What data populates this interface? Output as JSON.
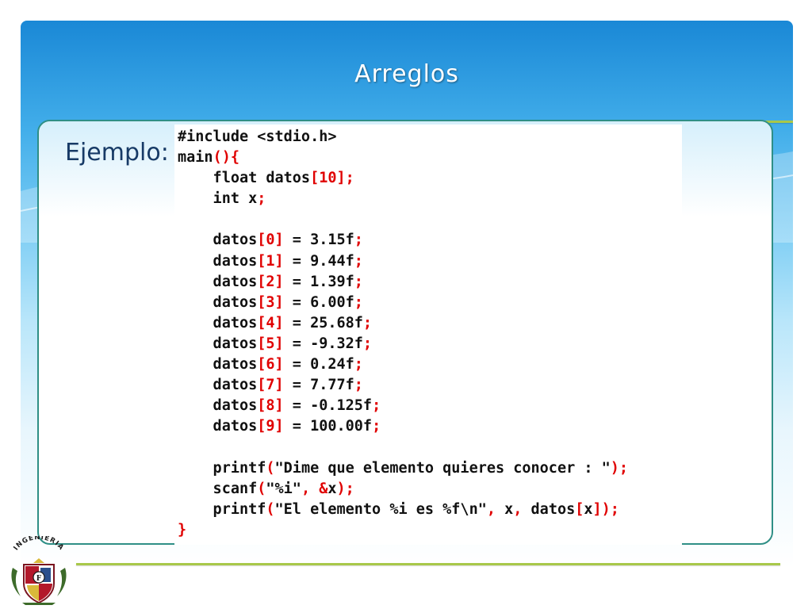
{
  "slide": {
    "title": "Arreglos",
    "example_label": "Ejemplo:",
    "logo_text": "INGENIERIA"
  },
  "colors": {
    "background_top": "#1a88d6",
    "accent_rule": "#a8c84a",
    "box_border": "#2f8f86",
    "label_text": "#173a66",
    "code_default": "#111111",
    "code_highlight": "#e00000"
  },
  "code_lines": [
    [
      {
        "t": "#include <stdio.h>",
        "k": "pre"
      }
    ],
    [
      {
        "t": "main",
        "k": "id"
      },
      {
        "t": "(){",
        "k": "punc"
      }
    ],
    [
      {
        "t": "    float datos",
        "k": "id"
      },
      {
        "t": "[",
        "k": "punc"
      },
      {
        "t": "10",
        "k": "num"
      },
      {
        "t": "];",
        "k": "punc"
      }
    ],
    [
      {
        "t": "    int x",
        "k": "id"
      },
      {
        "t": ";",
        "k": "punc"
      }
    ],
    [
      {
        "t": "",
        "k": "id"
      }
    ],
    [
      {
        "t": "    datos",
        "k": "id"
      },
      {
        "t": "[",
        "k": "punc"
      },
      {
        "t": "0",
        "k": "num"
      },
      {
        "t": "]",
        "k": "punc"
      },
      {
        "t": " = ",
        "k": "id"
      },
      {
        "t": "3.15f",
        "k": "id"
      },
      {
        "t": ";",
        "k": "punc"
      }
    ],
    [
      {
        "t": "    datos",
        "k": "id"
      },
      {
        "t": "[",
        "k": "punc"
      },
      {
        "t": "1",
        "k": "num"
      },
      {
        "t": "]",
        "k": "punc"
      },
      {
        "t": " = ",
        "k": "id"
      },
      {
        "t": "9.44f",
        "k": "id"
      },
      {
        "t": ";",
        "k": "punc"
      }
    ],
    [
      {
        "t": "    datos",
        "k": "id"
      },
      {
        "t": "[",
        "k": "punc"
      },
      {
        "t": "2",
        "k": "num"
      },
      {
        "t": "]",
        "k": "punc"
      },
      {
        "t": " = ",
        "k": "id"
      },
      {
        "t": "1.39f",
        "k": "id"
      },
      {
        "t": ";",
        "k": "punc"
      }
    ],
    [
      {
        "t": "    datos",
        "k": "id"
      },
      {
        "t": "[",
        "k": "punc"
      },
      {
        "t": "3",
        "k": "num"
      },
      {
        "t": "]",
        "k": "punc"
      },
      {
        "t": " = ",
        "k": "id"
      },
      {
        "t": "6.00f",
        "k": "id"
      },
      {
        "t": ";",
        "k": "punc"
      }
    ],
    [
      {
        "t": "    datos",
        "k": "id"
      },
      {
        "t": "[",
        "k": "punc"
      },
      {
        "t": "4",
        "k": "num"
      },
      {
        "t": "]",
        "k": "punc"
      },
      {
        "t": " = ",
        "k": "id"
      },
      {
        "t": "25.68f",
        "k": "id"
      },
      {
        "t": ";",
        "k": "punc"
      }
    ],
    [
      {
        "t": "    datos",
        "k": "id"
      },
      {
        "t": "[",
        "k": "punc"
      },
      {
        "t": "5",
        "k": "num"
      },
      {
        "t": "]",
        "k": "punc"
      },
      {
        "t": " = ",
        "k": "id"
      },
      {
        "t": "-9.32f",
        "k": "id"
      },
      {
        "t": ";",
        "k": "punc"
      }
    ],
    [
      {
        "t": "    datos",
        "k": "id"
      },
      {
        "t": "[",
        "k": "punc"
      },
      {
        "t": "6",
        "k": "num"
      },
      {
        "t": "]",
        "k": "punc"
      },
      {
        "t": " = ",
        "k": "id"
      },
      {
        "t": "0.24f",
        "k": "id"
      },
      {
        "t": ";",
        "k": "punc"
      }
    ],
    [
      {
        "t": "    datos",
        "k": "id"
      },
      {
        "t": "[",
        "k": "punc"
      },
      {
        "t": "7",
        "k": "num"
      },
      {
        "t": "]",
        "k": "punc"
      },
      {
        "t": " = ",
        "k": "id"
      },
      {
        "t": "7.77f",
        "k": "id"
      },
      {
        "t": ";",
        "k": "punc"
      }
    ],
    [
      {
        "t": "    datos",
        "k": "id"
      },
      {
        "t": "[",
        "k": "punc"
      },
      {
        "t": "8",
        "k": "num"
      },
      {
        "t": "]",
        "k": "punc"
      },
      {
        "t": " = ",
        "k": "id"
      },
      {
        "t": "-0.125f",
        "k": "id"
      },
      {
        "t": ";",
        "k": "punc"
      }
    ],
    [
      {
        "t": "    datos",
        "k": "id"
      },
      {
        "t": "[",
        "k": "punc"
      },
      {
        "t": "9",
        "k": "num"
      },
      {
        "t": "]",
        "k": "punc"
      },
      {
        "t": " = ",
        "k": "id"
      },
      {
        "t": "100.00f",
        "k": "id"
      },
      {
        "t": ";",
        "k": "punc"
      }
    ],
    [
      {
        "t": "",
        "k": "id"
      }
    ],
    [
      {
        "t": "    printf",
        "k": "id"
      },
      {
        "t": "(",
        "k": "punc"
      },
      {
        "t": "\"Dime que elemento quieres conocer : \"",
        "k": "id"
      },
      {
        "t": ");",
        "k": "punc"
      }
    ],
    [
      {
        "t": "    scanf",
        "k": "id"
      },
      {
        "t": "(",
        "k": "punc"
      },
      {
        "t": "\"%i\"",
        "k": "id"
      },
      {
        "t": ", &",
        "k": "punc"
      },
      {
        "t": "x",
        "k": "id"
      },
      {
        "t": ");",
        "k": "punc"
      }
    ],
    [
      {
        "t": "    printf",
        "k": "id"
      },
      {
        "t": "(",
        "k": "punc"
      },
      {
        "t": "\"El elemento %i es %f\\n\"",
        "k": "id"
      },
      {
        "t": ", ",
        "k": "punc"
      },
      {
        "t": "x",
        "k": "id"
      },
      {
        "t": ", ",
        "k": "punc"
      },
      {
        "t": "datos",
        "k": "id"
      },
      {
        "t": "[",
        "k": "punc"
      },
      {
        "t": "x",
        "k": "id"
      },
      {
        "t": "]);",
        "k": "punc"
      }
    ],
    [
      {
        "t": "}",
        "k": "punc"
      }
    ]
  ]
}
